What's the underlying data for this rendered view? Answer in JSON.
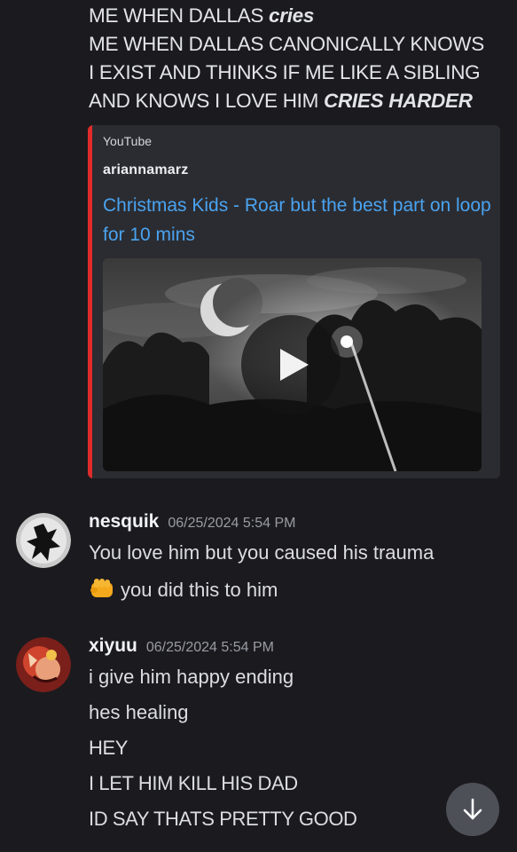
{
  "top_message": {
    "lines": [
      {
        "text": "ME WHEN DALLAS ",
        "emph": "cries"
      },
      {
        "text": "ME WHEN DALLAS CANONICALLY KNOWS",
        "emph": ""
      },
      {
        "text": "I EXIST AND THINKS IF ME LIKE A SIBLING",
        "emph": ""
      },
      {
        "text": "AND KNOWS I LOVE HIM ",
        "emph": "CRIES HARDER"
      }
    ]
  },
  "embed": {
    "provider": "YouTube",
    "author": "ariannamarz",
    "title": "Christmas Kids - Roar but the best part on loop for 10 mins",
    "accent_color": "#e02b2b"
  },
  "messages": [
    {
      "username": "nesquik",
      "timestamp": "06/25/2024 5:54 PM",
      "lines": [
        "You love him but you caused his trauma",
        "you did this to him"
      ],
      "emoji": "fist-icon"
    },
    {
      "username": "xiyuu",
      "timestamp": "06/25/2024 5:54 PM",
      "lines": [
        "i give him happy ending",
        "hes healing",
        "HEY",
        "I LET HIM KILL HIS DAD",
        "ID SAY THATS PRETTY GOOD"
      ]
    }
  ],
  "colors": {
    "background": "#1b1b1f",
    "embed_background": "#2b2c31",
    "link": "#4aa3f0",
    "timestamp": "#9a9ca4"
  },
  "icons": {
    "scroll_down": "arrow-down-icon",
    "play": "play-icon"
  }
}
